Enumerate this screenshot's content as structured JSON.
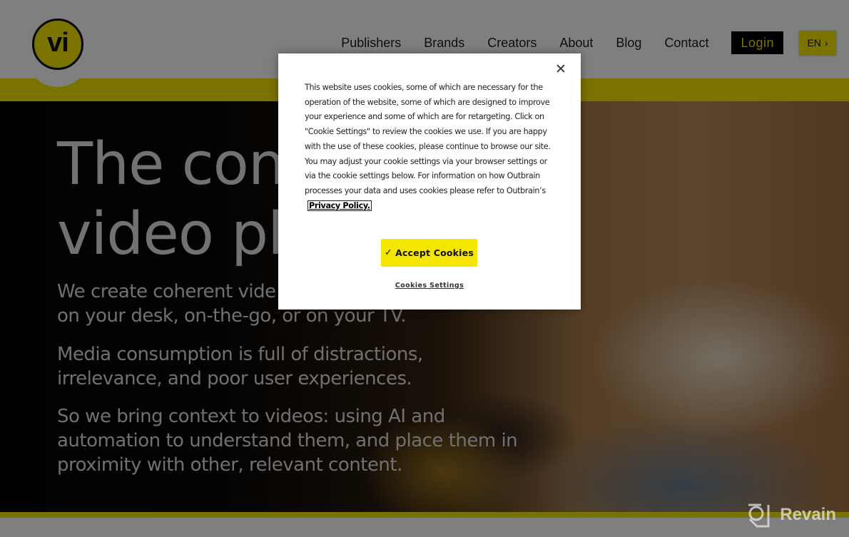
{
  "header": {
    "logo_text": "vi",
    "nav": [
      "Publishers",
      "Brands",
      "Creators",
      "About",
      "Blog",
      "Contact"
    ],
    "login_label": "Login",
    "language_label": "EN",
    "language_chevron": "›"
  },
  "hero": {
    "title_line1": "The con",
    "title_line2": "video pl",
    "paragraph1": "We create coherent vide\non your desk, on-the-go, or on your TV.",
    "paragraph2": "Media consumption is full of distractions,\nirrelevance, and poor user experiences.",
    "paragraph3": "So we bring context to videos: using AI and\nautomation to understand them, and place them in\nproximity with other, relevant content."
  },
  "cookie_dialog": {
    "close_symbol": "✕",
    "body_text": "This website uses cookies, some of which are necessary for the operation of the website, some of which are designed to improve your experience and some of which are for retargeting. Click on \"Cookie Settings\" to review the cookies we use. If you are happy with the use of these cookies, please continue to browse our site. You may adjust your cookie settings via your browser settings or via the cookie settings below. For information on how Outbrain processes your data and uses cookies please refer to Outbrain’s",
    "privacy_link": "Privacy Policy.",
    "accept_check": "✓",
    "accept_label": "Accept Cookies",
    "settings_label": "Cookies Settings"
  },
  "watermark": {
    "text": "Revain"
  },
  "colors": {
    "brand_yellow": "#f5e600",
    "login_bg": "#000000",
    "overlay": "rgba(0,0,0,0.5)"
  }
}
